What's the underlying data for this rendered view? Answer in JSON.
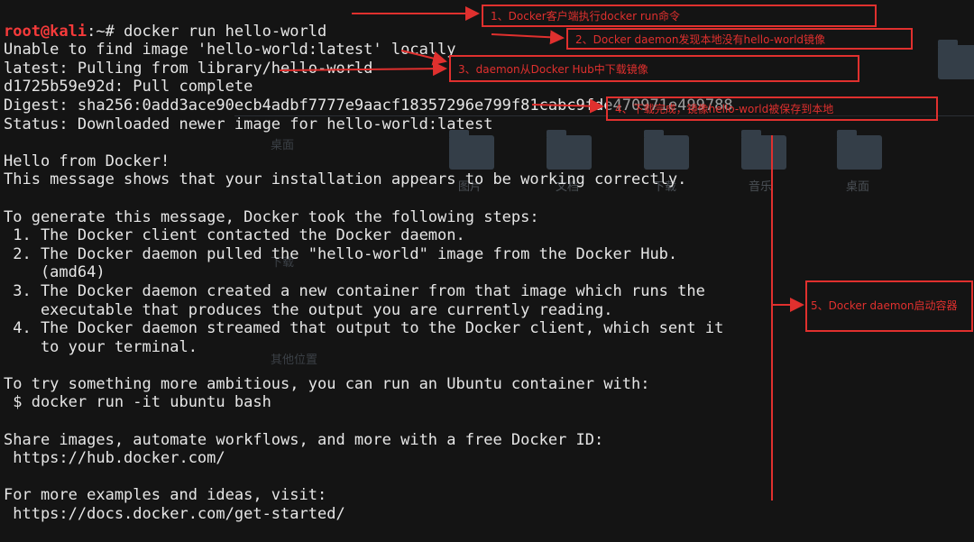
{
  "terminal": {
    "prompt_user": "root@kali",
    "prompt_path": ":~# ",
    "command": "docker run hello-world",
    "output_lines": [
      "Unable to find image 'hello-world:latest' locally",
      "latest: Pulling from library/hello-world",
      "d1725b59e92d: Pull complete",
      "Digest: sha256:0add3ace90ecb4adbf7777e9aacf18357296e799f81cabc9fde470971e499788",
      "Status: Downloaded newer image for hello-world:latest",
      "",
      "Hello from Docker!",
      "This message shows that your installation appears to be working correctly.",
      "",
      "To generate this message, Docker took the following steps:",
      " 1. The Docker client contacted the Docker daemon.",
      " 2. The Docker daemon pulled the \"hello-world\" image from the Docker Hub.",
      "    (amd64)",
      " 3. The Docker daemon created a new container from that image which runs the",
      "    executable that produces the output you are currently reading.",
      " 4. The Docker daemon streamed that output to the Docker client, which sent it",
      "    to your terminal.",
      "",
      "To try something more ambitious, you can run an Ubuntu container with:",
      " $ docker run -it ubuntu bash",
      "",
      "Share images, automate workflows, and more with a free Docker ID:",
      " https://hub.docker.com/",
      "",
      "For more examples and ideas, visit:",
      " https://docs.docker.com/get-started/"
    ]
  },
  "annotations": [
    "1、Docker客户端执行docker run命令",
    "2、Docker daemon发现本地没有hello-world镜像",
    "3、daemon从Docker Hub中下载镜像",
    "4、下载完成，镜像hello-world被保存到本地",
    "5、Docker daemon启动容器"
  ],
  "background_desktop": {
    "folder_labels": [
      "图片",
      "文档",
      "下载",
      "音乐",
      "桌面"
    ],
    "sidebar_items": [
      "桌面",
      "下载",
      "其他位置"
    ]
  },
  "colors": {
    "annotation_red": "#e0302e",
    "prompt_red": "#f53a3a",
    "terminal_text": "#e6e6e6",
    "background": "#141414"
  }
}
